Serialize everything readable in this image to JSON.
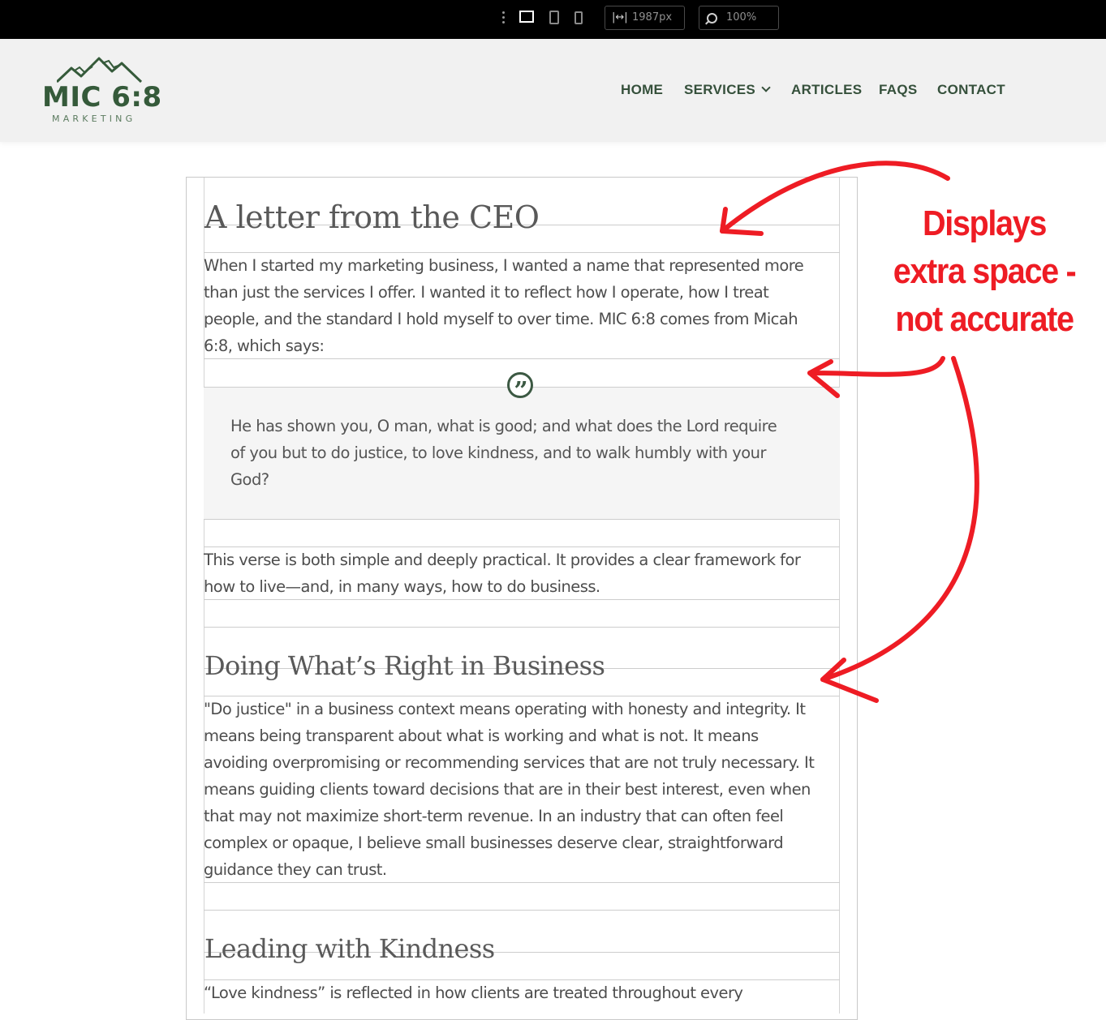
{
  "toolbar": {
    "width_value": "1987px",
    "zoom_value": "100%",
    "width_icon": "width-icon",
    "zoom_icon": "search-icon"
  },
  "header": {
    "logo_main": "MIC 6:8",
    "logo_sub": "MARKETING",
    "nav": [
      {
        "label": "HOME"
      },
      {
        "label": "SERVICES"
      },
      {
        "label": "ARTICLES"
      },
      {
        "label": "FAQS"
      },
      {
        "label": "CONTACT"
      }
    ]
  },
  "content": {
    "title": "A letter from the CEO",
    "intro_lines": [
      "When I started my marketing business, I wanted a name that represented more",
      "than just the services I offer. I wanted it to reflect how I operate, how I treat",
      "people, and the standard I hold myself to over time. MIC 6:8 comes from Micah",
      "6:8, which says:"
    ],
    "quote_lines": [
      "He has shown you, O man, what is good; and what does the Lord require",
      "of you but to do justice, to love kindness, and to walk humbly with your",
      "God?"
    ],
    "verse_lines": [
      "This verse is both simple and deeply practical. It provides a clear framework for",
      "how to live—and, in many ways, how to do business."
    ],
    "section2_title": "Doing What’s Right in Business",
    "section2_lines": [
      "\"Do justice\" in a business context means operating with honesty and integrity. It",
      "means being transparent about what is working and what is not. It means",
      "avoiding overpromising or recommending services that are not truly necessary. It",
      "means guiding clients toward decisions that are in their best interest, even when",
      "that may not maximize short-term revenue. In an industry that can often feel",
      "complex or opaque, I believe small businesses deserve clear, straightforward",
      "guidance they can trust."
    ],
    "section3_title": "Leading with Kindness",
    "section3_lines": [
      "“Love kindness” is reflected in how clients are treated throughout every"
    ]
  },
  "annotation": {
    "lines": [
      "Displays",
      "extra space -",
      "not accurate"
    ],
    "color": "#ee1c24"
  },
  "colors": {
    "brand_green": "#355a3a",
    "toolbar_bg": "#000000",
    "header_bg": "#f1f1f1"
  }
}
